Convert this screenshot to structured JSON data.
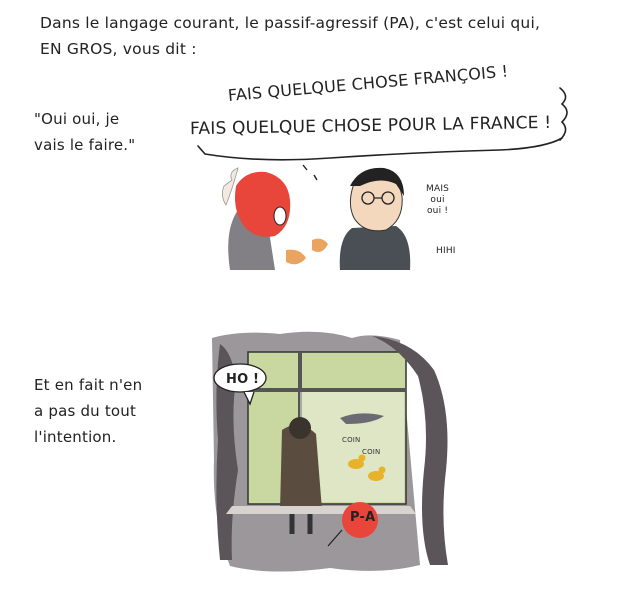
{
  "intro": {
    "line1": "Dans le langage courant, le passif-agressif (PA), c'est celui qui,",
    "line2": "EN GROS, vous dit :"
  },
  "quote": {
    "line1": "\"Oui oui, je",
    "line2": "vais le faire.\""
  },
  "speech": {
    "line1": "FAIS QUELQUE CHOSE FRANÇOIS !",
    "line2": "FAIS QUELQUE CHOSE POUR LA FRANCE !"
  },
  "reply": {
    "line1": "MAIS",
    "line2": "oui",
    "line3": "oui !",
    "aside": "HIHI"
  },
  "truth": {
    "line1": "Et en fait n'en",
    "line2": "a pas du tout",
    "line3": "l'intention."
  },
  "scene": {
    "exclamation": "HO !",
    "duck_sound1": "COIN",
    "duck_sound2": "COIN",
    "badge": "P-A"
  },
  "colors": {
    "ink": "#222222",
    "red": "#e8463a",
    "duck_yellow": "#e9b22b",
    "curtain_grey": "#5b5458",
    "window_green": "#c9d8a0"
  }
}
